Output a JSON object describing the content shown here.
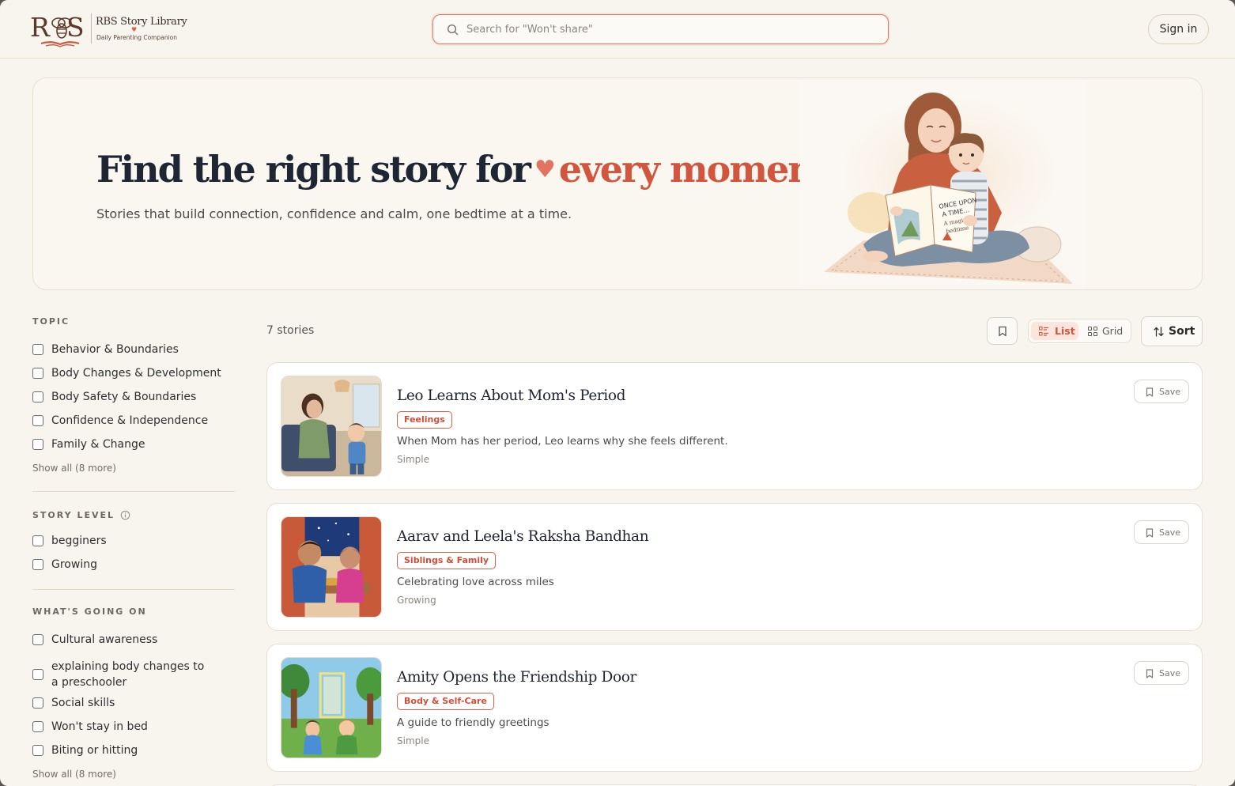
{
  "brand": {
    "mark": "RS",
    "title": "RBS Story Library",
    "subtitle": "Daily Parenting Companion"
  },
  "search": {
    "placeholder": "Search for \"Won't share\"",
    "value": ""
  },
  "header": {
    "signin_label": "Sign in"
  },
  "hero": {
    "title_main": "Find the right story for",
    "title_accent": "every moment.",
    "subtitle": "Stories that build connection, confidence and calm, one bedtime at a time.",
    "illustration_book_text": "ONCE UPON A TIME... A magical bedtime story"
  },
  "filters": {
    "topic": {
      "heading": "TOPIC",
      "items": [
        "Behavior & Boundaries",
        "Body Changes & Development",
        "Body Safety & Boundaries",
        "Confidence & Independence",
        "Family & Change"
      ],
      "show_all": "Show all (8 more)"
    },
    "story_level": {
      "heading": "STORY LEVEL",
      "items": [
        "begginers",
        "Growing"
      ]
    },
    "whats_going_on": {
      "heading": "WHAT'S GOING ON",
      "items": [
        "Cultural awareness",
        "explaining body changes to a preschooler",
        "Social skills",
        "Won't stay in bed",
        "Biting or hitting"
      ],
      "show_all": "Show all (8 more)"
    }
  },
  "results": {
    "count_label": "7 stories",
    "view": {
      "list_label": "List",
      "grid_label": "Grid",
      "selected": "List"
    },
    "sort_label": "Sort"
  },
  "stories": [
    {
      "title": "Leo Learns About Mom's Period",
      "tag": "Feelings",
      "description": "When Mom has her period, Leo learns why she feels different.",
      "level": "Simple",
      "save_label": "Save"
    },
    {
      "title": "Aarav and Leela's Raksha Bandhan",
      "tag": "Siblings & Family",
      "description": "Celebrating love across miles",
      "level": "Growing",
      "save_label": "Save"
    },
    {
      "title": "Amity Opens the Friendship Door",
      "tag": "Body & Self-Care",
      "description": "A guide to friendly greetings",
      "level": "Simple",
      "save_label": "Save"
    }
  ],
  "colors": {
    "accent": "#d2553d",
    "background": "#f8f4ee",
    "title_dark": "#1e2533"
  }
}
